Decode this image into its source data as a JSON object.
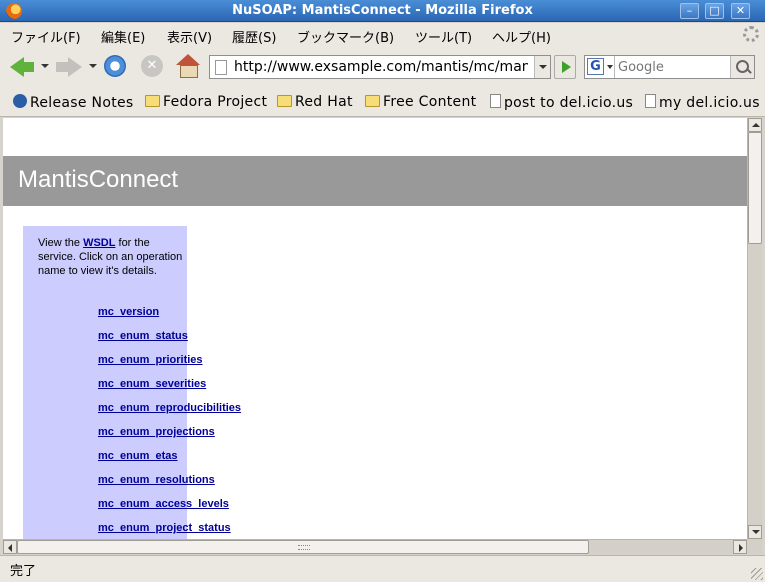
{
  "window": {
    "title": "NuSOAP: MantisConnect - Mozilla Firefox",
    "minimize_label": "–",
    "maximize_label": "□",
    "close_label": "✕"
  },
  "menu": {
    "items": [
      {
        "label": "ファイル(F)"
      },
      {
        "label": "編集(E)"
      },
      {
        "label": "表示(V)"
      },
      {
        "label": "履歴(S)"
      },
      {
        "label": "ブックマーク(B)"
      },
      {
        "label": "ツール(T)"
      },
      {
        "label": "ヘルプ(H)"
      }
    ]
  },
  "toolbar": {
    "back_icon": "back-arrow-icon",
    "forward_icon": "forward-arrow-icon",
    "reload_icon": "reload-icon",
    "stop_icon": "stop-icon",
    "home_icon": "home-icon",
    "url": "http://www.exsample.com/mantis/mc/mantisconnect.php",
    "search_engine_logo": "G",
    "search_placeholder": "Google"
  },
  "bookmarks": {
    "items": [
      {
        "label": "Release Notes",
        "icon": "fedora-icon"
      },
      {
        "label": "Fedora Project",
        "icon": "folder-icon"
      },
      {
        "label": "Red Hat",
        "icon": "folder-icon"
      },
      {
        "label": "Free Content",
        "icon": "folder-icon"
      },
      {
        "label": "post to del.icio.us",
        "icon": "page-icon"
      },
      {
        "label": "my del.icio.us",
        "icon": "page-icon"
      }
    ]
  },
  "page": {
    "heading": "MantisConnect",
    "intro_before": "View the ",
    "intro_link": "WSDL",
    "intro_after": " for the service. Click on an operation name to view it's details.",
    "operations": [
      "mc_version",
      "mc_enum_status",
      "mc_enum_priorities",
      "mc_enum_severities",
      "mc_enum_reproducibilities",
      "mc_enum_projections",
      "mc_enum_etas",
      "mc_enum_resolutions",
      "mc_enum_access_levels",
      "mc_enum_project_status"
    ]
  },
  "status": {
    "text": "完了"
  },
  "colors": {
    "banner": "#999999",
    "sidebar": "#ccccff",
    "link": "#000099"
  }
}
